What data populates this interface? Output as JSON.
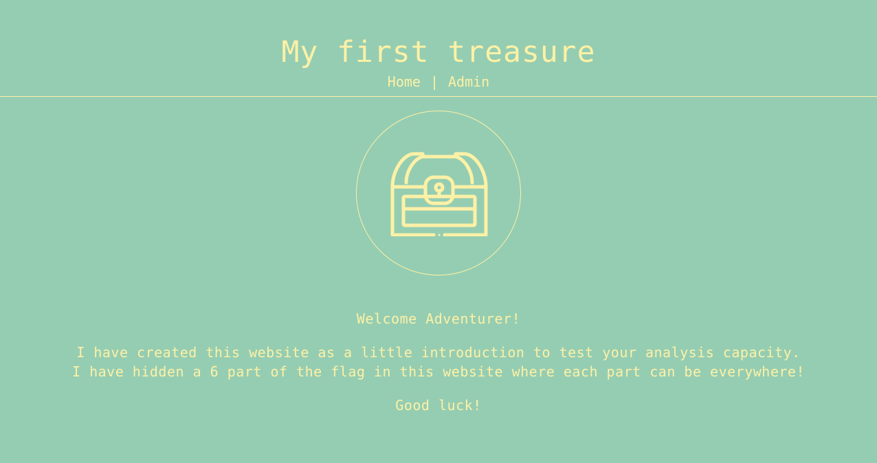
{
  "header": {
    "title": "My first treasure",
    "nav": {
      "home": "Home",
      "separator": "|",
      "admin": "Admin"
    }
  },
  "emblem": {
    "icon": "treasure-chest-icon"
  },
  "main": {
    "welcome": "Welcome Adventurer!",
    "intro_line_1": "I have created this website as a little introduction to test your analysis capacity.",
    "intro_line_2": "I have hidden a 6 part of the flag in this website where each part can be everywhere!",
    "closing": "Good luck!"
  },
  "colors": {
    "background": "#95cdb2",
    "accent": "#fdf1a6"
  }
}
